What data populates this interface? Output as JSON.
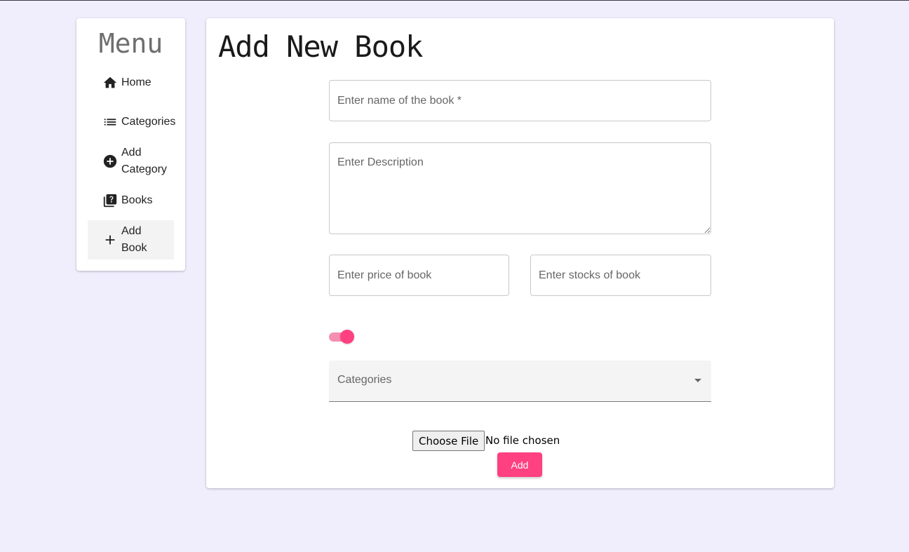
{
  "sidebar": {
    "title": "Menu",
    "items": [
      {
        "label": "Home",
        "icon": "home-icon"
      },
      {
        "label": "Categories",
        "icon": "list-icon"
      },
      {
        "label": "Add Category",
        "icon": "add-circle-icon"
      },
      {
        "label": "Books",
        "icon": "quiz-book-icon"
      },
      {
        "label": "Add Book",
        "icon": "plus-icon"
      }
    ],
    "active_item": "Add Book"
  },
  "main": {
    "title": "Add New Book",
    "form": {
      "name_placeholder": "Enter name of the book *",
      "description_placeholder": "Enter Description",
      "price_placeholder": "Enter price of book",
      "stocks_placeholder": "Enter stocks of book",
      "toggle_on": true,
      "categories_label": "Categories",
      "choose_file_label": "Choose File",
      "file_status": "No file chosen",
      "submit_label": "Add"
    }
  },
  "colors": {
    "background": "#f0eefd",
    "accent": "#ff4081",
    "accent_light": "#f48fb1"
  }
}
